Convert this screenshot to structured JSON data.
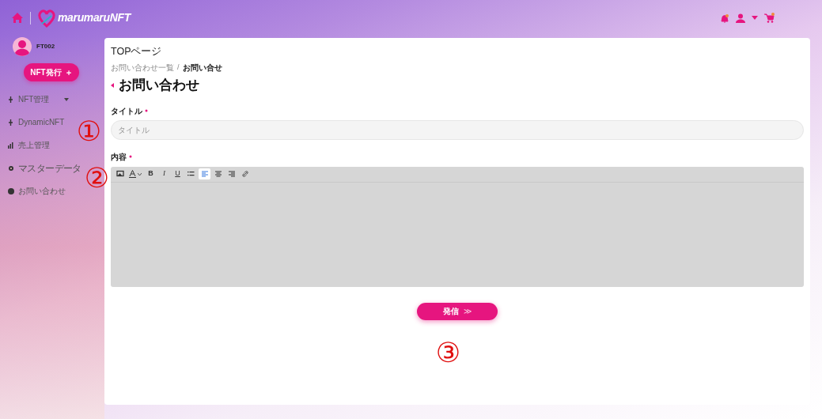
{
  "header": {
    "logo": "marumaruNFT"
  },
  "user": {
    "name": "FT002"
  },
  "nft_button": {
    "label": "NFT発行",
    "icon": "＋"
  },
  "sidebar": {
    "items": [
      {
        "label": "NFT管理",
        "expandable": true
      },
      {
        "label": "DynamicNFT",
        "expandable": false
      },
      {
        "label": "売上管理",
        "expandable": false
      },
      {
        "label": "マスターデータ",
        "expandable": false
      },
      {
        "label": "お問い合わせ",
        "expandable": false
      }
    ]
  },
  "top_link": "TOPページ",
  "breadcrumb_separator": "/",
  "breadcrumb": [
    {
      "label": "お問い合わせ一覧",
      "current": false
    },
    {
      "label": "お問い合せ",
      "current": true
    }
  ],
  "page_title": "お問い合わせ",
  "form": {
    "title_field": {
      "label": "タイトル",
      "required": true,
      "placeholder": "タイトル"
    },
    "content_field": {
      "label": "内容",
      "required": true,
      "toolbar": [
        {
          "kind": "image",
          "selected": false
        },
        {
          "kind": "color",
          "selected": false
        },
        {
          "kind": "bold",
          "label": "B",
          "selected": false
        },
        {
          "kind": "italic",
          "label": "I",
          "selected": false
        },
        {
          "kind": "underline",
          "label": "U",
          "selected": false
        },
        {
          "kind": "list",
          "selected": false
        },
        {
          "kind": "align-left",
          "selected": true
        },
        {
          "kind": "align-center",
          "selected": false
        },
        {
          "kind": "align-right",
          "selected": false
        },
        {
          "kind": "link",
          "selected": false
        }
      ]
    }
  },
  "submit": {
    "label": "発信",
    "icon": "≫"
  },
  "annotations": [
    "①",
    "②",
    "③"
  ]
}
